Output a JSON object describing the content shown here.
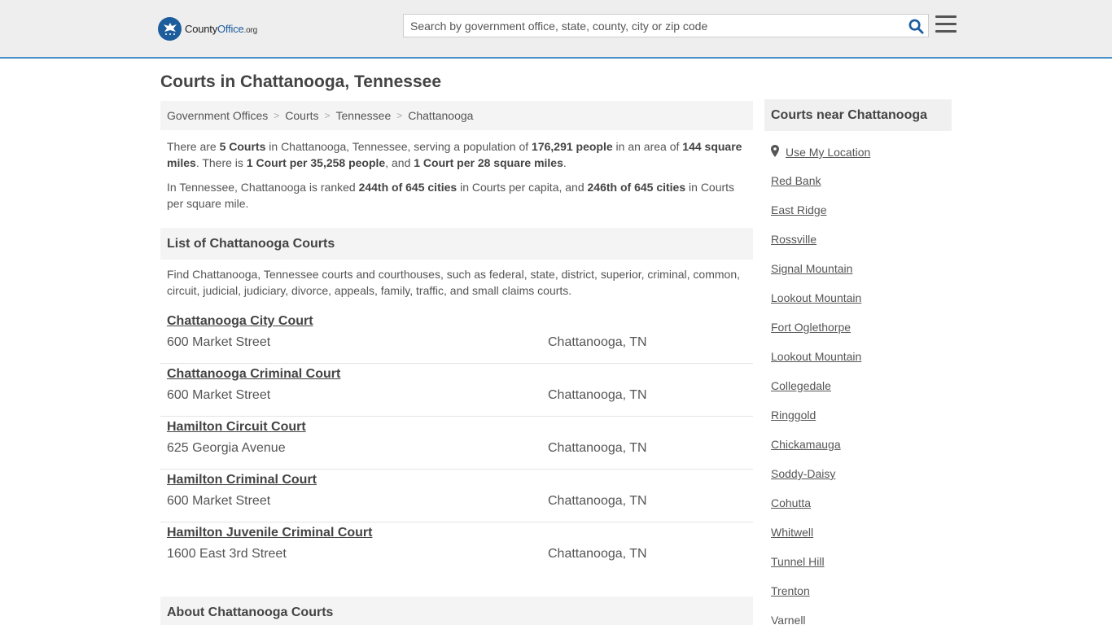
{
  "header": {
    "logo": {
      "brand_prefix": "County",
      "brand_name": "Office",
      "brand_tld": ".org"
    },
    "search": {
      "placeholder": "Search by government office, state, county, city or zip code"
    },
    "icons": {
      "search": "search-icon",
      "menu": "hamburger-menu-icon",
      "logo": "eagle-seal-icon"
    }
  },
  "page": {
    "title": "Courts in Chattanooga, Tennessee"
  },
  "breadcrumb": [
    "Government Offices",
    "Courts",
    "Tennessee",
    "Chattanooga"
  ],
  "intro": {
    "p1": {
      "t1": "There are ",
      "b1": "5 Courts",
      "t2": " in Chattanooga, Tennessee, serving a population of ",
      "b2": "176,291 people",
      "t3": " in an area of ",
      "b3": "144 square miles",
      "t4": ". There is ",
      "b4": "1 Court per 35,258 people",
      "t5": ", and ",
      "b5": "1 Court per 28 square miles",
      "t6": "."
    },
    "p2": {
      "t1": "In Tennessee, Chattanooga is ranked ",
      "b1": "244th of 645 cities",
      "t2": " in Courts per capita, and ",
      "b2": "246th of 645 cities",
      "t3": " in Courts per square mile."
    }
  },
  "list_section": {
    "title": "List of Chattanooga Courts",
    "description": "Find Chattanooga, Tennessee courts and courthouses, such as federal, state, district, superior, criminal, common, circuit, judicial, judiciary, divorce, appeals, family, traffic, and small claims courts.",
    "items": [
      {
        "name": "Chattanooga City Court",
        "address": "600 Market Street",
        "city": "Chattanooga, TN"
      },
      {
        "name": "Chattanooga Criminal Court",
        "address": "600 Market Street",
        "city": "Chattanooga, TN"
      },
      {
        "name": "Hamilton Circuit Court",
        "address": "625 Georgia Avenue",
        "city": "Chattanooga, TN"
      },
      {
        "name": "Hamilton Criminal Court",
        "address": "600 Market Street",
        "city": "Chattanooga, TN"
      },
      {
        "name": "Hamilton Juvenile Criminal Court",
        "address": "1600 East 3rd Street",
        "city": "Chattanooga, TN"
      }
    ]
  },
  "about_section": {
    "title": "About Chattanooga Courts"
  },
  "sidebar": {
    "title": "Courts near Chattanooga",
    "use_location": "Use My Location",
    "location_icon": "map-pin-icon",
    "places": [
      "Red Bank",
      "East Ridge",
      "Rossville",
      "Signal Mountain",
      "Lookout Mountain",
      "Fort Oglethorpe",
      "Lookout Mountain",
      "Collegedale",
      "Ringgold",
      "Chickamauga",
      "Soddy-Daisy",
      "Cohutta",
      "Whitwell",
      "Tunnel Hill",
      "Trenton",
      "Varnell"
    ]
  },
  "colors": {
    "accent": "#1d5d9c",
    "header_bg": "#eeeeee",
    "header_border": "#4a90c8",
    "panel_bg": "#f4f4f4"
  }
}
